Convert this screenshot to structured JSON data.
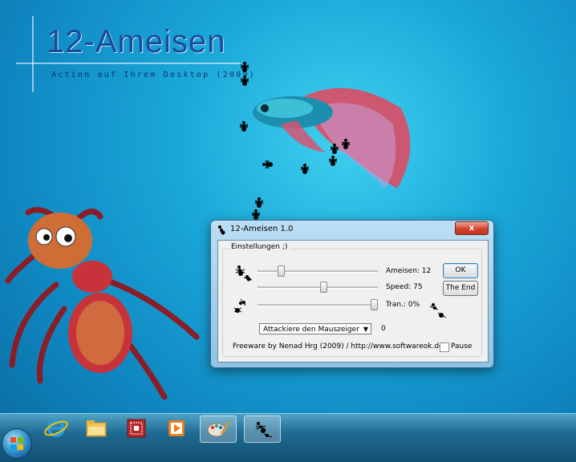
{
  "desktop": {
    "banner_title": "12-Ameisen",
    "banner_subtitle": "Action auf Ihrem Desktop (2009)"
  },
  "dialog": {
    "title": "12-Ameisen 1.0",
    "close_label": "x",
    "group_label": "Einstellungen ;)",
    "sliders": [
      {
        "label": "Ameisen: 12",
        "level": 0.18
      },
      {
        "label": "Speed: 75",
        "level": 0.55
      },
      {
        "label": "Tran.: 0%",
        "level": 1.0
      }
    ],
    "ok_label": "OK",
    "end_label": "The End",
    "mode_select": "Attackiere den Mauszeiger",
    "mode_value": "0",
    "footer": "Freeware by Nenad Hrg (2009) / http://www.softwareok.de/",
    "pause_label": "Pause"
  },
  "taskbar": {
    "items": [
      "internet-explorer-icon",
      "file-explorer-icon",
      "app-icon",
      "media-player-icon",
      "paint-icon",
      "ants-icon"
    ]
  }
}
